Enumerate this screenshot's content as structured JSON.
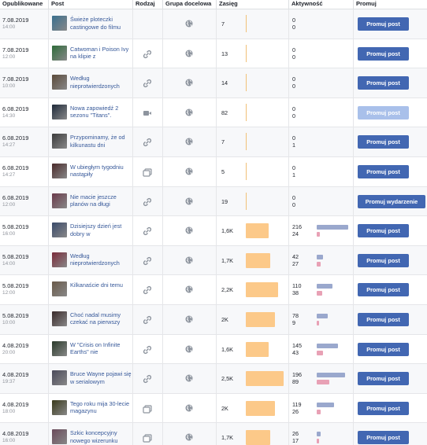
{
  "headers": {
    "published": "Opublikowane",
    "post": "Post",
    "type": "Rodzaj",
    "target": "Grupa docelowa",
    "reach": "Zasięg",
    "activity": "Aktywność",
    "promote": "Promuj"
  },
  "colors": {
    "button": "#4267b2",
    "button_disabled": "#a9c0ea",
    "reach_bar": "#fcc989",
    "activity_bar_1": "#9aa8cd",
    "activity_bar_2": "#e8a1b5",
    "link": "#365899"
  },
  "rows": [
    {
      "date": "7.08.2019",
      "time": "14:00",
      "text": "Świeże ploteczki castingowe do filmu",
      "type_icon": "none",
      "reach": "7",
      "reach_frac": 0,
      "act1": "0",
      "act2": "0",
      "act1_frac": 0,
      "act2_frac": 0,
      "button": "Promuj post",
      "button_state": "enabled",
      "thumb": "#3a6f8e"
    },
    {
      "date": "7.08.2019",
      "time": "12:00",
      "text": "Catwoman i Poison Ivy na klipie z",
      "type_icon": "link-icon",
      "reach": "13",
      "reach_frac": 0,
      "act1": "0",
      "act2": "0",
      "act1_frac": 0,
      "act2_frac": 0,
      "button": "Promuj post",
      "button_state": "enabled",
      "thumb": "#2e6b3a"
    },
    {
      "date": "7.08.2019",
      "time": "10:00",
      "text": "Według nieprotwierdzonych",
      "type_icon": "link-icon",
      "reach": "14",
      "reach_frac": 0,
      "act1": "0",
      "act2": "0",
      "act1_frac": 0,
      "act2_frac": 0,
      "button": "Promuj post",
      "button_state": "enabled",
      "thumb": "#5a4a3a"
    },
    {
      "date": "6.08.2019",
      "time": "14:30",
      "text": "Nowa zapowiedź 2 sezonu \"Titans\".",
      "type_icon": "video-icon",
      "reach": "82",
      "reach_frac": 0,
      "act1": "0",
      "act2": "0",
      "act1_frac": 0,
      "act2_frac": 0,
      "button": "Promuj post",
      "button_state": "disabled",
      "thumb": "#1e2a3a"
    },
    {
      "date": "6.08.2019",
      "time": "14:27",
      "text": "Przypominamy, że od kilkunastu dni",
      "type_icon": "link-icon",
      "reach": "7",
      "reach_frac": 0,
      "act1": "0",
      "act2": "1",
      "act1_frac": 0,
      "act2_frac": 0,
      "button": "Promuj post",
      "button_state": "enabled",
      "thumb": "#3c3c3c"
    },
    {
      "date": "6.08.2019",
      "time": "14:27",
      "text": "W ubiegłym tygodniu nastąpiły",
      "type_icon": "gallery-icon",
      "reach": "5",
      "reach_frac": 0,
      "act1": "0",
      "act2": "1",
      "act1_frac": 0,
      "act2_frac": 0,
      "button": "Promuj post",
      "button_state": "enabled",
      "thumb": "#4a2a2a"
    },
    {
      "date": "6.08.2019",
      "time": "12:00",
      "text": "Nie macie jeszcze planów na długi",
      "type_icon": "link-icon",
      "reach": "19",
      "reach_frac": 0,
      "act1": "0",
      "act2": "0",
      "act1_frac": 0,
      "act2_frac": 0,
      "button": "Promuj wydarzenie",
      "button_state": "wide",
      "thumb": "#6a3a4a"
    },
    {
      "date": "5.08.2019",
      "time": "16:00",
      "text": "Dzisiejszy dzień jest dobry w",
      "type_icon": "link-icon",
      "reach": "1,6K",
      "reach_frac": 0.6,
      "act1": "216",
      "act2": "24",
      "act1_frac": 1.0,
      "act2_frac": 0.11,
      "button": "Promuj post",
      "button_state": "enabled",
      "thumb": "#3a4a6a"
    },
    {
      "date": "5.08.2019",
      "time": "14:00",
      "text": "Według nieprotwierdzonych",
      "type_icon": "link-icon",
      "reach": "1,7K",
      "reach_frac": 0.64,
      "act1": "42",
      "act2": "27",
      "act1_frac": 0.19,
      "act2_frac": 0.12,
      "button": "Promuj post",
      "button_state": "enabled",
      "thumb": "#7a2a3a"
    },
    {
      "date": "5.08.2019",
      "time": "12:00",
      "text": "Kilkanaście dni temu",
      "type_icon": "link-icon",
      "reach": "2,2K",
      "reach_frac": 0.85,
      "act1": "110",
      "act2": "38",
      "act1_frac": 0.51,
      "act2_frac": 0.18,
      "button": "Promuj post",
      "button_state": "enabled",
      "thumb": "#6a5a4a"
    },
    {
      "date": "5.08.2019",
      "time": "10:00",
      "text": "Choć nadal musimy czekać na pierwszy",
      "type_icon": "link-icon",
      "reach": "2K",
      "reach_frac": 0.77,
      "act1": "78",
      "act2": "9",
      "act1_frac": 0.36,
      "act2_frac": 0.04,
      "button": "Promuj post",
      "button_state": "enabled",
      "thumb": "#3a2a2a"
    },
    {
      "date": "4.08.2019",
      "time": "20:00",
      "text": "W \"Crisis on Infinite Earths\" nie",
      "type_icon": "link-icon",
      "reach": "1,6K",
      "reach_frac": 0.6,
      "act1": "145",
      "act2": "43",
      "act1_frac": 0.67,
      "act2_frac": 0.2,
      "button": "Promuj post",
      "button_state": "enabled",
      "thumb": "#2a3a2a"
    },
    {
      "date": "4.08.2019",
      "time": "19:37",
      "text": "Bruce Wayne pojawi się w serialowym",
      "type_icon": "link-icon",
      "reach": "2,5K",
      "reach_frac": 1.0,
      "act1": "196",
      "act2": "89",
      "act1_frac": 0.91,
      "act2_frac": 0.41,
      "button": "Promuj post",
      "button_state": "enabled",
      "thumb": "#4a4a5a"
    },
    {
      "date": "4.08.2019",
      "time": "18:00",
      "text": "Tego roku mija 30-lecie magazynu",
      "type_icon": "gallery-icon",
      "reach": "2K",
      "reach_frac": 0.77,
      "act1": "119",
      "act2": "26",
      "act1_frac": 0.55,
      "act2_frac": 0.12,
      "button": "Promuj post",
      "button_state": "enabled",
      "thumb": "#3a3a1a"
    },
    {
      "date": "4.08.2019",
      "time": "16:00",
      "text": "Szkic koncepcyjny nowego wizerunku",
      "type_icon": "gallery-icon",
      "reach": "1,7K",
      "reach_frac": 0.64,
      "act1": "26",
      "act2": "17",
      "act1_frac": 0.12,
      "act2_frac": 0.08,
      "button": "Promuj post",
      "button_state": "enabled",
      "thumb": "#6a4a5a"
    }
  ]
}
